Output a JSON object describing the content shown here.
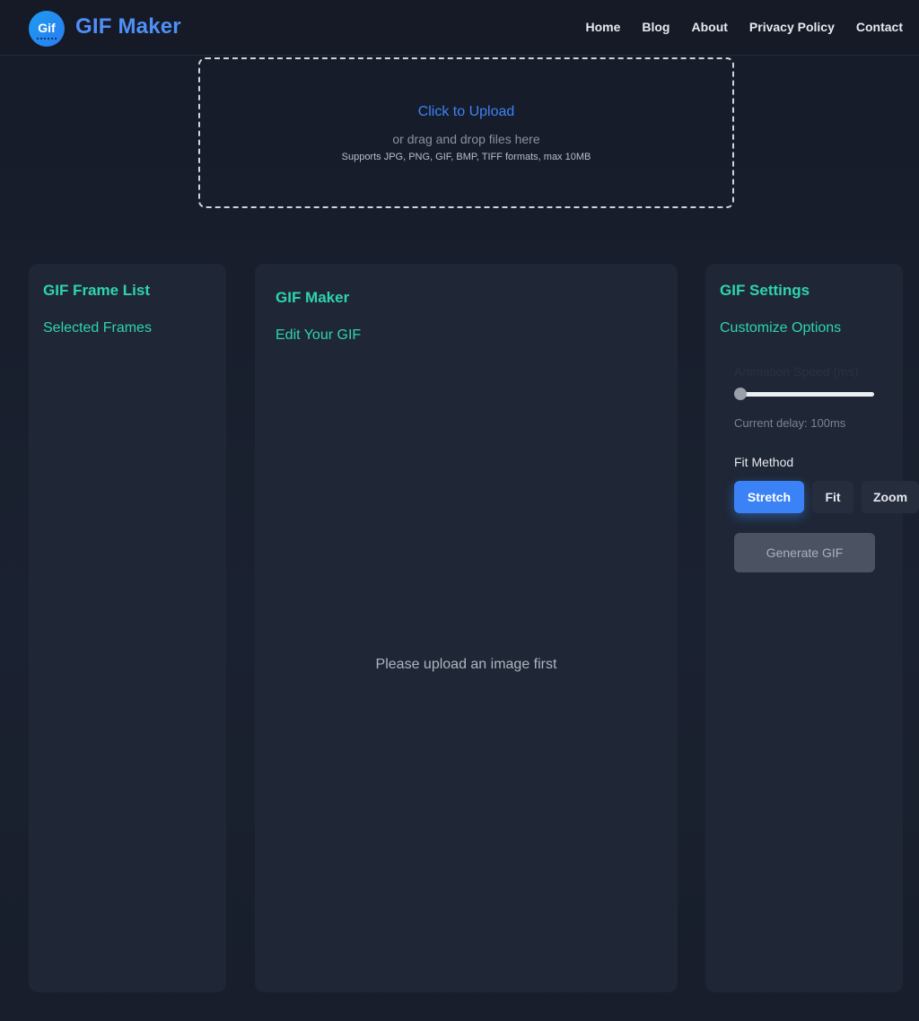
{
  "header": {
    "logo_text": "Gif",
    "brand": "GIF Maker",
    "nav": [
      {
        "label": "Home"
      },
      {
        "label": "Blog"
      },
      {
        "label": "About"
      },
      {
        "label": "Privacy Policy"
      },
      {
        "label": "Contact"
      }
    ]
  },
  "upload": {
    "link": "Click to Upload",
    "hint": "or drag and drop files here",
    "formats": "Supports JPG, PNG, GIF, BMP, TIFF formats, max 10MB"
  },
  "frames_panel": {
    "title": "GIF Frame List",
    "subtitle": "Selected Frames"
  },
  "editor_panel": {
    "title": "GIF Maker",
    "subtitle": "Edit Your GIF",
    "empty_message": "Please upload an image first"
  },
  "settings_panel": {
    "title": "GIF Settings",
    "subtitle": "Customize Options",
    "speed_label": "Animation Speed (ms)",
    "speed_value": 0,
    "delay_text": "Current delay: 100ms",
    "fit_label": "Fit Method",
    "fit_options": [
      {
        "label": "Stretch",
        "selected": true
      },
      {
        "label": "Fit",
        "selected": false
      },
      {
        "label": "Zoom",
        "selected": false
      }
    ],
    "generate_label": "Generate GIF"
  },
  "colors": {
    "accent": "#3b82f6",
    "heading": "#2fd3b0",
    "brand": "#4f8ff7",
    "panel": "#1f2736"
  }
}
